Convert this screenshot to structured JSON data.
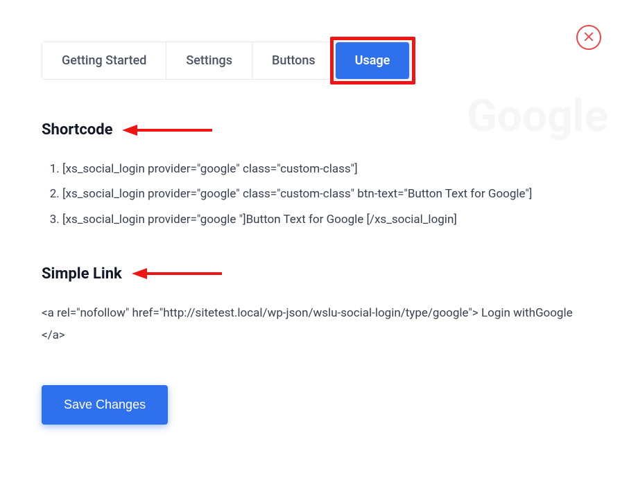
{
  "watermark": "Google",
  "tabs": {
    "items": [
      {
        "label": "Getting Started"
      },
      {
        "label": "Settings"
      },
      {
        "label": "Buttons"
      },
      {
        "label": "Usage"
      }
    ],
    "activeIndex": 3
  },
  "sections": {
    "shortcode": {
      "title": "Shortcode",
      "items": [
        "[xs_social_login provider=\"google\" class=\"custom-class\"]",
        "[xs_social_login provider=\"google\" class=\"custom-class\" btn-text=\"Button Text for Google\"]",
        "[xs_social_login provider=\"google \"]Button Text for Google [/xs_social_login]"
      ]
    },
    "simpleLink": {
      "title": "Simple Link",
      "code": "<a rel=\"nofollow\" href=\"http://sitetest.local/wp-json/wslu-social-login/type/google\"> Login withGoogle </a>"
    }
  },
  "buttons": {
    "save": "Save Changes"
  }
}
